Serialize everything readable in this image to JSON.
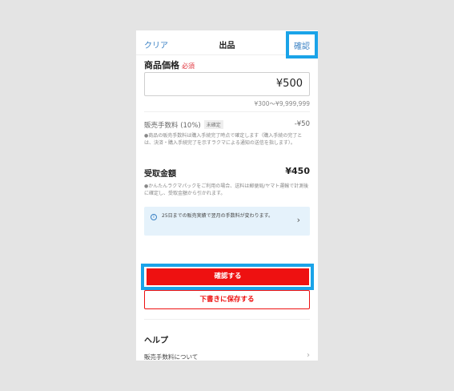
{
  "nav": {
    "clear_label": "クリア",
    "title": "出品",
    "confirm_label": "確認"
  },
  "price": {
    "section_title": "商品価格",
    "required_label": "必須",
    "value": "¥500",
    "range": "¥300～¥9,999,999"
  },
  "fee": {
    "label": "販売手数料 (10%)",
    "badge": "未確定",
    "value": "-¥50",
    "note": "●商品の販売手数料は購入手続完了時点で確定します（購入手続の完了とは、決済・購入手続完了を示すラクマによる通知の送信を指します）。"
  },
  "receive": {
    "label": "受取金額",
    "value": "¥450",
    "note": "●かんたんラクマパックをご利用の場合、送料は郵便局/ヤマト運輸で計測後に確定し、受取金額から引かれます。"
  },
  "info": {
    "icon": "info-icon",
    "text": "25日までの販売実績で翌月の手数料が変わります。",
    "chevron": "›"
  },
  "actions": {
    "confirm_label": "確認する",
    "draft_label": "下書きに保存する"
  },
  "help": {
    "title": "ヘルプ",
    "item_label": "販売手数料について",
    "chevron": "›"
  },
  "colors": {
    "accent_blue": "#3b82c4",
    "highlight": "#1aa3e8",
    "primary_red": "#ee1111",
    "required_red": "#e0303a"
  }
}
